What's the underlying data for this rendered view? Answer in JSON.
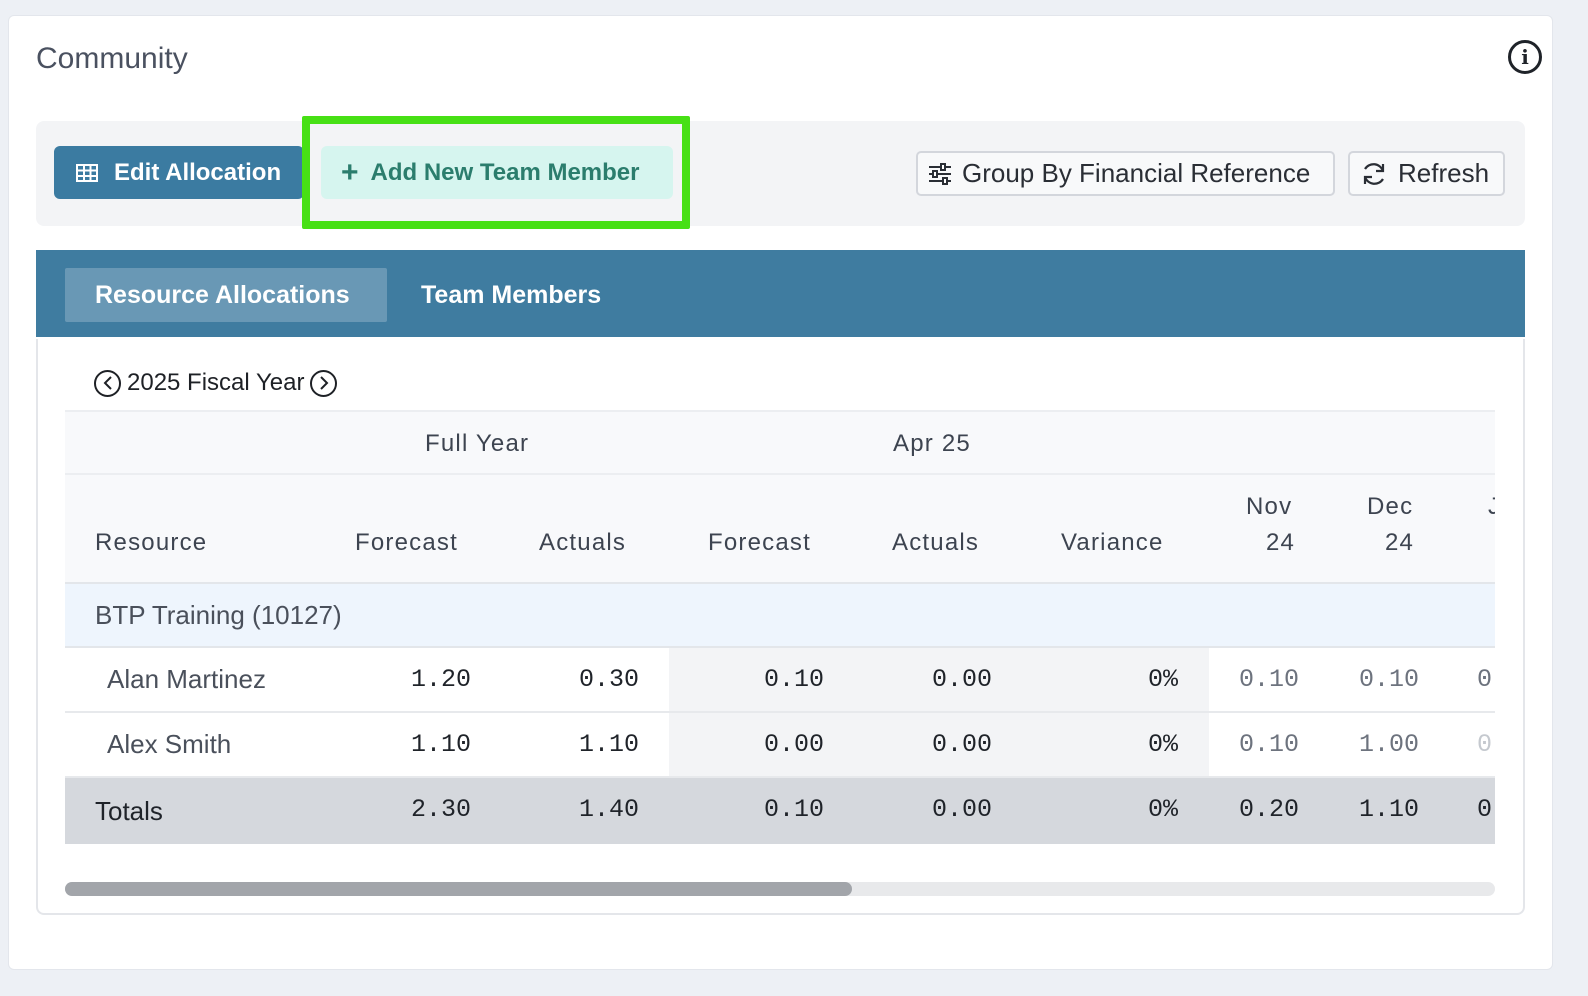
{
  "card": {
    "title": "Community",
    "info_icon": "info-circle-icon"
  },
  "toolbar": {
    "edit_allocation": "Edit Allocation",
    "add_member": "Add New Team Member",
    "group_by": "Group By Financial Reference",
    "refresh": "Refresh"
  },
  "tabs": [
    {
      "label": "Resource Allocations",
      "active": true
    },
    {
      "label": "Team Members",
      "active": false
    }
  ],
  "fiscal_year": "2025 Fiscal Year",
  "table": {
    "group_headers": {
      "full_year": "Full Year",
      "apr": "Apr 25"
    },
    "columns": {
      "resource": "Resource",
      "fy_forecast": "Forecast",
      "fy_actuals": "Actuals",
      "apr_forecast": "Forecast",
      "apr_actuals": "Actuals",
      "variance": "Variance",
      "nov_a": "Nov",
      "nov_b": "24",
      "dec_a": "Dec",
      "dec_b": "24",
      "jan_a": "J"
    },
    "group_label": "BTP Training (10127)",
    "rows": [
      {
        "name": "Alan Martinez",
        "fy_forecast": "1.20",
        "fy_actuals": "0.30",
        "apr_forecast": "0.10",
        "apr_actuals": "0.00",
        "variance": "0%",
        "nov": "0.10",
        "dec": "0.10",
        "jan": "0"
      },
      {
        "name": "Alex Smith",
        "fy_forecast": "1.10",
        "fy_actuals": "1.10",
        "apr_forecast": "0.00",
        "apr_actuals": "0.00",
        "variance": "0%",
        "nov": "0.10",
        "dec": "1.00",
        "jan": "0"
      }
    ],
    "totals": {
      "name": "Totals",
      "fy_forecast": "2.30",
      "fy_actuals": "1.40",
      "apr_forecast": "0.10",
      "apr_actuals": "0.00",
      "variance": "0%",
      "nov": "0.20",
      "dec": "1.10",
      "jan": "0"
    }
  },
  "scroll_fraction": 0.55
}
